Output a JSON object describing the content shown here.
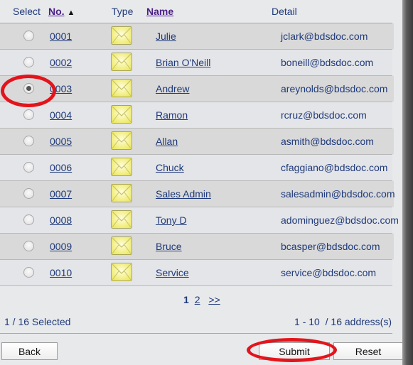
{
  "header": {
    "select": "Select",
    "no": "No.",
    "sort_indicator": "▲",
    "type": "Type",
    "name": "Name",
    "detail": "Detail"
  },
  "rows": [
    {
      "no": "0001",
      "type_icon": "envelope-icon",
      "name": "Julie",
      "detail": "jclark@bdsdoc.com",
      "selected": false
    },
    {
      "no": "0002",
      "type_icon": "envelope-icon",
      "name": "Brian O'Neill",
      "detail": "boneill@bdsdoc.com",
      "selected": false
    },
    {
      "no": "0003",
      "type_icon": "envelope-icon",
      "name": "Andrew",
      "detail": "areynolds@bdsdoc.com",
      "selected": true
    },
    {
      "no": "0004",
      "type_icon": "envelope-icon",
      "name": "Ramon",
      "detail": "rcruz@bdsdoc.com",
      "selected": false
    },
    {
      "no": "0005",
      "type_icon": "envelope-icon",
      "name": "Allan",
      "detail": "asmith@bdsdoc.com",
      "selected": false
    },
    {
      "no": "0006",
      "type_icon": "envelope-icon",
      "name": "Chuck",
      "detail": "cfaggiano@bdsdoc.com",
      "selected": false
    },
    {
      "no": "0007",
      "type_icon": "envelope-icon",
      "name": "Sales Admin",
      "detail": "salesadmin@bdsdoc.com",
      "selected": false
    },
    {
      "no": "0008",
      "type_icon": "envelope-icon",
      "name": "Tony D",
      "detail": "adominguez@bdsdoc.com",
      "selected": false
    },
    {
      "no": "0009",
      "type_icon": "envelope-icon",
      "name": "Bruce",
      "detail": "bcasper@bdsdoc.com",
      "selected": false
    },
    {
      "no": "0010",
      "type_icon": "envelope-icon",
      "name": "Service",
      "detail": "service@bdsdoc.com",
      "selected": false
    }
  ],
  "pagination": {
    "current": "1",
    "pages": [
      "2"
    ],
    "next": ">>"
  },
  "status": {
    "selected": "1 / 16 Selected",
    "range": "1 - 10  / 16 address(s)"
  },
  "buttons": {
    "back": "Back",
    "submit": "Submit",
    "reset": "Reset"
  },
  "colors": {
    "text": "#1f3a7a",
    "sort_link": "#4b1f87",
    "row_odd": "#d9d9d9",
    "row_even": "#e4e5e8",
    "annotation": "#e3141b",
    "envelope": "#f3f08a"
  }
}
